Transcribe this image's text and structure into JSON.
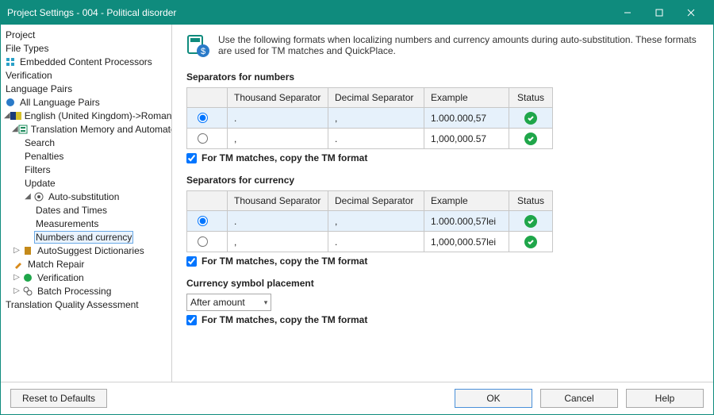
{
  "window": {
    "title": "Project Settings - 004 - Political disorder"
  },
  "tree": {
    "project": "Project",
    "file_types": "File Types",
    "embedded": "Embedded Content Processors",
    "verification_top": "Verification",
    "language_pairs": "Language Pairs",
    "all_language_pairs": "All Language Pairs",
    "lang_pair": "English (United Kingdom)->Romanian (Ro",
    "tm_auto": "Translation Memory and Automated Tr",
    "search": "Search",
    "penalties": "Penalties",
    "filters": "Filters",
    "update": "Update",
    "auto_sub": "Auto-substitution",
    "dates_times": "Dates and Times",
    "measurements": "Measurements",
    "numbers_currency": "Numbers and currency",
    "autosuggest": "AutoSuggest Dictionaries",
    "match_repair": "Match Repair",
    "verification_lp": "Verification",
    "batch_processing": "Batch Processing",
    "tqa": "Translation Quality Assessment"
  },
  "intro": "Use the following formats when localizing numbers and currency amounts during auto-substitution. These formats are used for TM matches and QuickPlace.",
  "sections": {
    "numbers": {
      "heading": "Separators for numbers",
      "row1": {
        "thousand": ".",
        "decimal": ",",
        "example": "1.000.000,57"
      },
      "row2": {
        "thousand": ",",
        "decimal": ".",
        "example": "1,000,000.57"
      },
      "copy_label": "For TM matches, copy the TM format"
    },
    "currency": {
      "heading": "Separators for currency",
      "row1": {
        "thousand": ".",
        "decimal": ",",
        "example": "1.000.000,57lei"
      },
      "row2": {
        "thousand": ",",
        "decimal": ".",
        "example": "1,000,000.57lei"
      },
      "copy_label": "For TM matches, copy the TM format"
    },
    "placement": {
      "heading": "Currency symbol placement",
      "value": "After amount",
      "copy_label": "For TM matches, copy the TM format"
    }
  },
  "table_headers": {
    "thousand": "Thousand Separator",
    "decimal": "Decimal Separator",
    "example": "Example",
    "status": "Status"
  },
  "footer": {
    "reset": "Reset to Defaults",
    "ok": "OK",
    "cancel": "Cancel",
    "help": "Help"
  }
}
